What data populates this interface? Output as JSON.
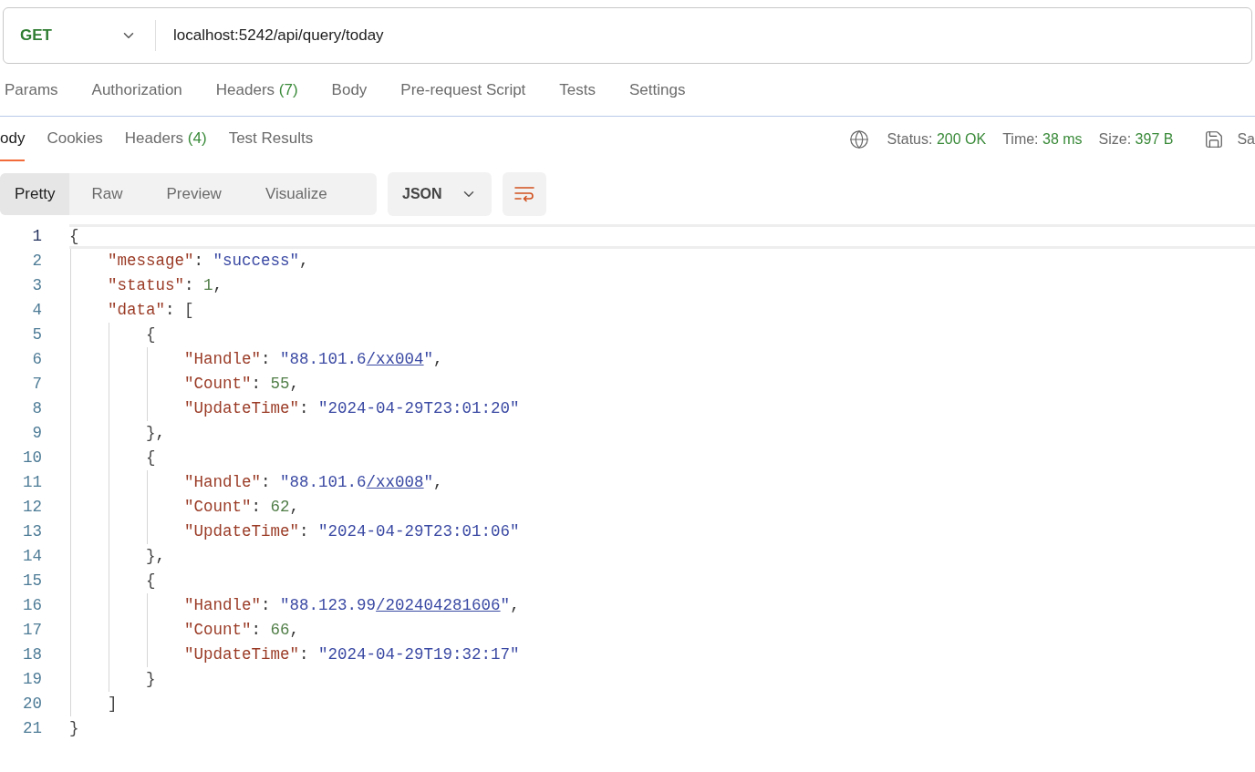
{
  "request": {
    "method": "GET",
    "url": "localhost:5242/api/query/today"
  },
  "request_tabs": [
    {
      "label": "Params"
    },
    {
      "label": "Authorization"
    },
    {
      "label": "Headers",
      "count": "(7)"
    },
    {
      "label": "Body"
    },
    {
      "label": "Pre-request Script"
    },
    {
      "label": "Tests"
    },
    {
      "label": "Settings"
    }
  ],
  "response_tabs": [
    {
      "label": "ody",
      "selected": true
    },
    {
      "label": "Cookies",
      "selected": false
    },
    {
      "label": "Headers",
      "count": "(4)",
      "selected": false
    },
    {
      "label": "Test Results",
      "selected": false
    }
  ],
  "response_meta": [
    {
      "label": "Status:",
      "value": "200 OK"
    },
    {
      "label": "Time:",
      "value": "38 ms"
    },
    {
      "label": "Size:",
      "value": "397 B"
    }
  ],
  "save_label": "Sa",
  "view_modes": [
    {
      "label": "Pretty",
      "selected": true
    },
    {
      "label": "Raw",
      "selected": false
    },
    {
      "label": "Preview",
      "selected": false
    },
    {
      "label": "Visualize",
      "selected": false
    }
  ],
  "format": "JSON",
  "code_lines": [
    {
      "number": "1",
      "selected": true,
      "tokens": [
        {
          "kind": "open",
          "text": "{"
        }
      ]
    },
    {
      "number": "2",
      "selected": false,
      "tokens": [
        {
          "kind": "key",
          "text": "\"message\""
        },
        {
          "kind": "punct",
          "text": ": "
        },
        {
          "kind": "string",
          "text": "\"success\""
        },
        {
          "kind": "punct",
          "text": ","
        }
      ]
    },
    {
      "number": "3",
      "selected": false,
      "tokens": [
        {
          "kind": "key",
          "text": "\"status\""
        },
        {
          "kind": "punct",
          "text": ": "
        },
        {
          "kind": "number",
          "text": "1"
        },
        {
          "kind": "punct",
          "text": ","
        }
      ]
    },
    {
      "number": "4",
      "selected": false,
      "tokens": [
        {
          "kind": "key",
          "text": "\"data\""
        },
        {
          "kind": "punct",
          "text": ": "
        },
        {
          "kind": "open",
          "text": "["
        }
      ]
    },
    {
      "number": "5",
      "selected": false,
      "tokens": [
        {
          "kind": "open",
          "text": "{"
        }
      ]
    },
    {
      "number": "6",
      "selected": false,
      "tokens": [
        {
          "kind": "key",
          "text": "\"Handle\""
        },
        {
          "kind": "punct",
          "text": ": "
        },
        {
          "kind": "string",
          "text": "\"88.101.6"
        },
        {
          "kind": "link",
          "text": "/xx004"
        },
        {
          "kind": "string",
          "text": "\""
        },
        {
          "kind": "punct",
          "text": ","
        }
      ]
    },
    {
      "number": "7",
      "selected": false,
      "tokens": [
        {
          "kind": "key",
          "text": "\"Count\""
        },
        {
          "kind": "punct",
          "text": ": "
        },
        {
          "kind": "number",
          "text": "55"
        },
        {
          "kind": "punct",
          "text": ","
        }
      ]
    },
    {
      "number": "8",
      "selected": false,
      "tokens": [
        {
          "kind": "key",
          "text": "\"UpdateTime\""
        },
        {
          "kind": "punct",
          "text": ": "
        },
        {
          "kind": "string",
          "text": "\"2024-04-29T23:01:20\""
        }
      ]
    },
    {
      "number": "9",
      "selected": false,
      "tokens": [
        {
          "kind": "close",
          "text": "}"
        },
        {
          "kind": "punct",
          "text": ","
        }
      ]
    },
    {
      "number": "10",
      "selected": false,
      "tokens": [
        {
          "kind": "open",
          "text": "{"
        }
      ]
    },
    {
      "number": "11",
      "selected": false,
      "tokens": [
        {
          "kind": "key",
          "text": "\"Handle\""
        },
        {
          "kind": "punct",
          "text": ": "
        },
        {
          "kind": "string",
          "text": "\"88.101.6"
        },
        {
          "kind": "link",
          "text": "/xx008"
        },
        {
          "kind": "string",
          "text": "\""
        },
        {
          "kind": "punct",
          "text": ","
        }
      ]
    },
    {
      "number": "12",
      "selected": false,
      "tokens": [
        {
          "kind": "key",
          "text": "\"Count\""
        },
        {
          "kind": "punct",
          "text": ": "
        },
        {
          "kind": "number",
          "text": "62"
        },
        {
          "kind": "punct",
          "text": ","
        }
      ]
    },
    {
      "number": "13",
      "selected": false,
      "tokens": [
        {
          "kind": "key",
          "text": "\"UpdateTime\""
        },
        {
          "kind": "punct",
          "text": ": "
        },
        {
          "kind": "string",
          "text": "\"2024-04-29T23:01:06\""
        }
      ]
    },
    {
      "number": "14",
      "selected": false,
      "tokens": [
        {
          "kind": "close",
          "text": "}"
        },
        {
          "kind": "punct",
          "text": ","
        }
      ]
    },
    {
      "number": "15",
      "selected": false,
      "tokens": [
        {
          "kind": "open",
          "text": "{"
        }
      ]
    },
    {
      "number": "16",
      "selected": false,
      "tokens": [
        {
          "kind": "key",
          "text": "\"Handle\""
        },
        {
          "kind": "punct",
          "text": ": "
        },
        {
          "kind": "string",
          "text": "\"88.123.99"
        },
        {
          "kind": "link",
          "text": "/202404281606"
        },
        {
          "kind": "string",
          "text": "\""
        },
        {
          "kind": "punct",
          "text": ","
        }
      ]
    },
    {
      "number": "17",
      "selected": false,
      "tokens": [
        {
          "kind": "key",
          "text": "\"Count\""
        },
        {
          "kind": "punct",
          "text": ": "
        },
        {
          "kind": "number",
          "text": "66"
        },
        {
          "kind": "punct",
          "text": ","
        }
      ]
    },
    {
      "number": "18",
      "selected": false,
      "tokens": [
        {
          "kind": "key",
          "text": "\"UpdateTime\""
        },
        {
          "kind": "punct",
          "text": ": "
        },
        {
          "kind": "string",
          "text": "\"2024-04-29T19:32:17\""
        }
      ]
    },
    {
      "number": "19",
      "selected": false,
      "tokens": [
        {
          "kind": "close",
          "text": "}"
        }
      ]
    },
    {
      "number": "20",
      "selected": false,
      "tokens": [
        {
          "kind": "close",
          "text": "]"
        }
      ]
    },
    {
      "number": "21",
      "selected": false,
      "tokens": [
        {
          "kind": "close",
          "text": "}"
        }
      ]
    }
  ]
}
